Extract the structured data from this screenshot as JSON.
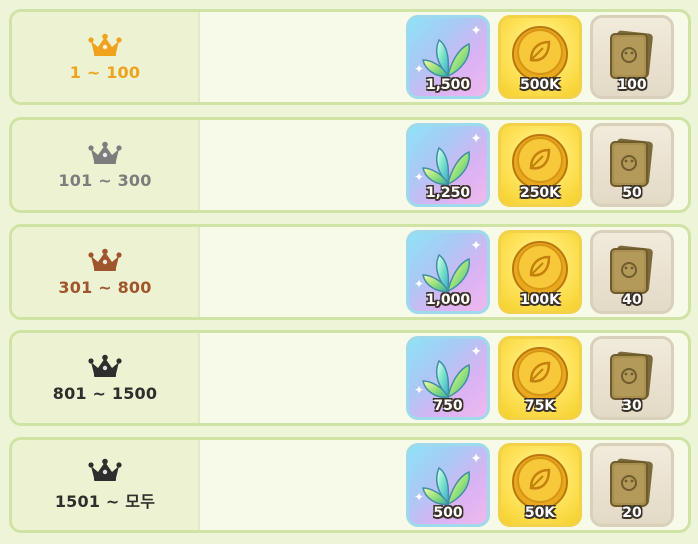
{
  "colors": {
    "gold": "#f0a21d",
    "silver": "#8d8d8d",
    "bronze": "#a0562c",
    "dark": "#2e2e2e"
  },
  "tiers": [
    {
      "range": "1 ~ 100",
      "crown_icon": "gold-crown-icon",
      "color": "#f0a21d",
      "rewards": [
        {
          "icon": "crystal-leaf-icon",
          "amount": "1,500"
        },
        {
          "icon": "gold-coin-icon",
          "amount": "500K"
        },
        {
          "icon": "stone-box-icon",
          "amount": "100"
        }
      ]
    },
    {
      "range": "101 ~ 300",
      "crown_icon": "silver-crown-icon",
      "color": "#7d7d7d",
      "rewards": [
        {
          "icon": "crystal-leaf-icon",
          "amount": "1,250"
        },
        {
          "icon": "gold-coin-icon",
          "amount": "250K"
        },
        {
          "icon": "stone-box-icon",
          "amount": "50"
        }
      ]
    },
    {
      "range": "301 ~ 800",
      "crown_icon": "bronze-crown-icon",
      "color": "#a0562c",
      "rewards": [
        {
          "icon": "crystal-leaf-icon",
          "amount": "1,000"
        },
        {
          "icon": "gold-coin-icon",
          "amount": "100K"
        },
        {
          "icon": "stone-box-icon",
          "amount": "40"
        }
      ]
    },
    {
      "range": "801 ~ 1500",
      "crown_icon": "dark-crown-icon",
      "color": "#2e2e2e",
      "rewards": [
        {
          "icon": "crystal-leaf-icon",
          "amount": "750"
        },
        {
          "icon": "gold-coin-icon",
          "amount": "75K"
        },
        {
          "icon": "stone-box-icon",
          "amount": "30"
        }
      ]
    },
    {
      "range": "1501 ~ 모두",
      "crown_icon": "dark-crown-icon",
      "color": "#2e2e2e",
      "rewards": [
        {
          "icon": "crystal-leaf-icon",
          "amount": "500"
        },
        {
          "icon": "gold-coin-icon",
          "amount": "50K"
        },
        {
          "icon": "stone-box-icon",
          "amount": "20"
        }
      ]
    }
  ]
}
